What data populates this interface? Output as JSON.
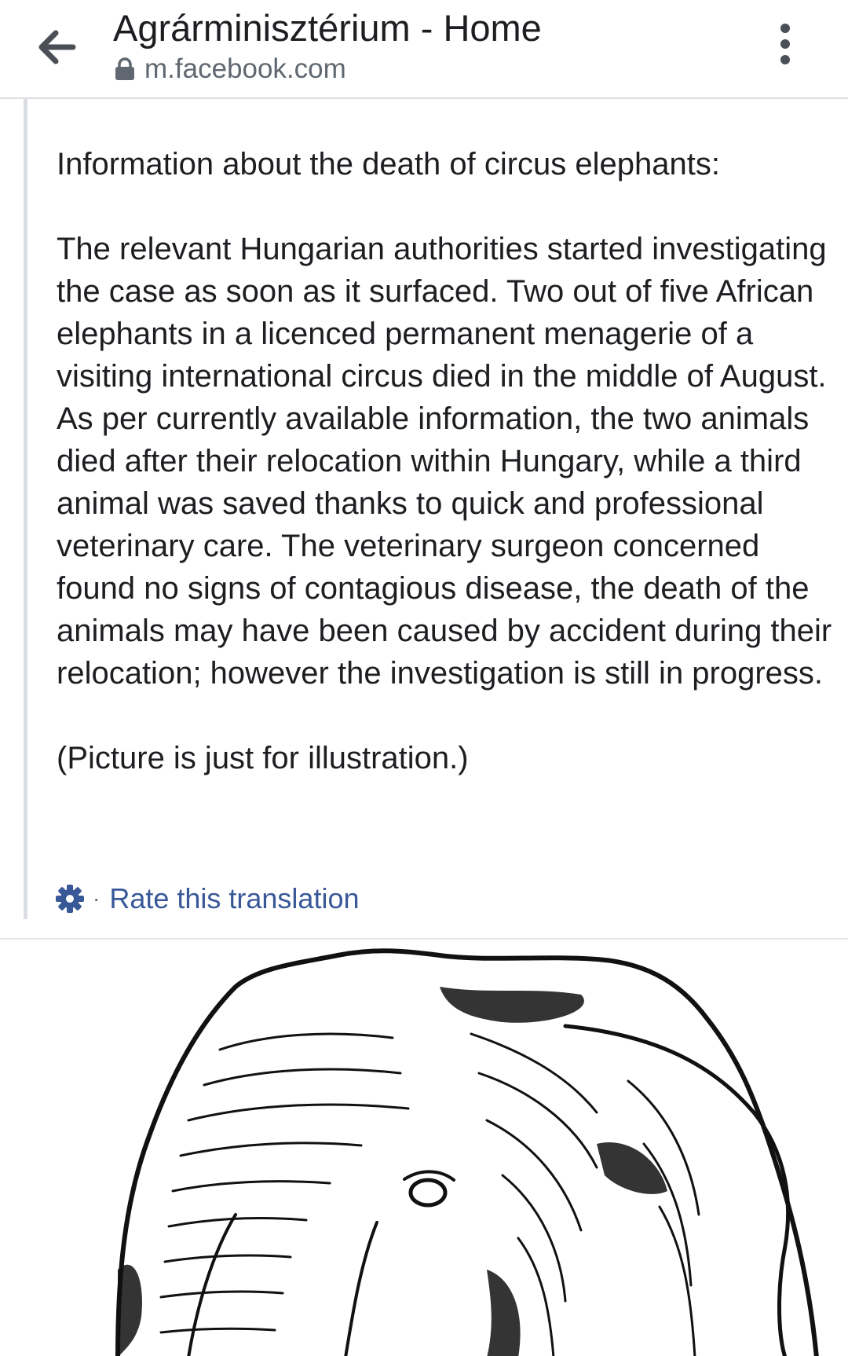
{
  "header": {
    "title": "Agrárminisztérium - Home",
    "url": "m.facebook.com"
  },
  "post": {
    "heading": "Information about the death of circus elephants:",
    "body": "The relevant Hungarian authorities started investigating the case as soon as it surfaced. Two out of five African elephants in a licenced permanent menagerie of a visiting international circus died in the middle of August. As per currently available information, the two animals died after their relocation within Hungary, while a third animal was saved thanks to quick and professional veterinary care. The veterinary surgeon concerned found no signs of contagious disease, the death of the animals may have been caused by accident during their relocation; however the investigation is still in progress.",
    "note": "(Picture is just for illustration.)",
    "rate_translation_label": "Rate this translation",
    "separator": "·"
  },
  "icons": {
    "back": "back-arrow-icon",
    "lock": "lock-icon",
    "menu": "more-vertical-icon",
    "settings": "gear-icon"
  },
  "colors": {
    "link": "#385898",
    "text": "#1c1e21",
    "muted": "#606770",
    "icon": "#4b4f56",
    "divider": "#dadde1"
  }
}
